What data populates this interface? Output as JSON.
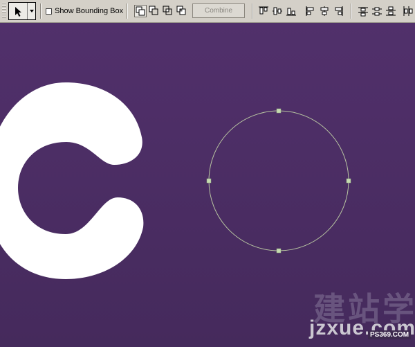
{
  "options_bar": {
    "show_bounding_box_label": "Show Bounding Box",
    "show_bounding_box_checked": false,
    "combine_label": "Combine",
    "tool_icon": "path-selection-arrow-icon",
    "shape_mode_icons": [
      "add-to-shape-area-icon",
      "subtract-from-shape-area-icon",
      "intersect-shape-areas-icon",
      "exclude-overlapping-shape-areas-icon"
    ],
    "align_icons": [
      "align-top-edges-icon",
      "align-vertical-centers-icon",
      "align-bottom-edges-icon",
      "align-left-edges-icon",
      "align-horizontal-centers-icon",
      "align-right-edges-icon"
    ],
    "distribute_icons": [
      "distribute-top-edges-icon",
      "distribute-vertical-centers-icon",
      "distribute-bottom-edges-icon",
      "distribute-left-edges-icon"
    ]
  },
  "canvas": {
    "background_color": "#4b2c63",
    "shape_color": "#ffffff",
    "path_color": "#b9c6a2",
    "anchor_color": "#c6dcb0"
  },
  "watermark": {
    "chinese": "建站学",
    "url": "jzxue.com",
    "badge": "PS369.COM"
  }
}
